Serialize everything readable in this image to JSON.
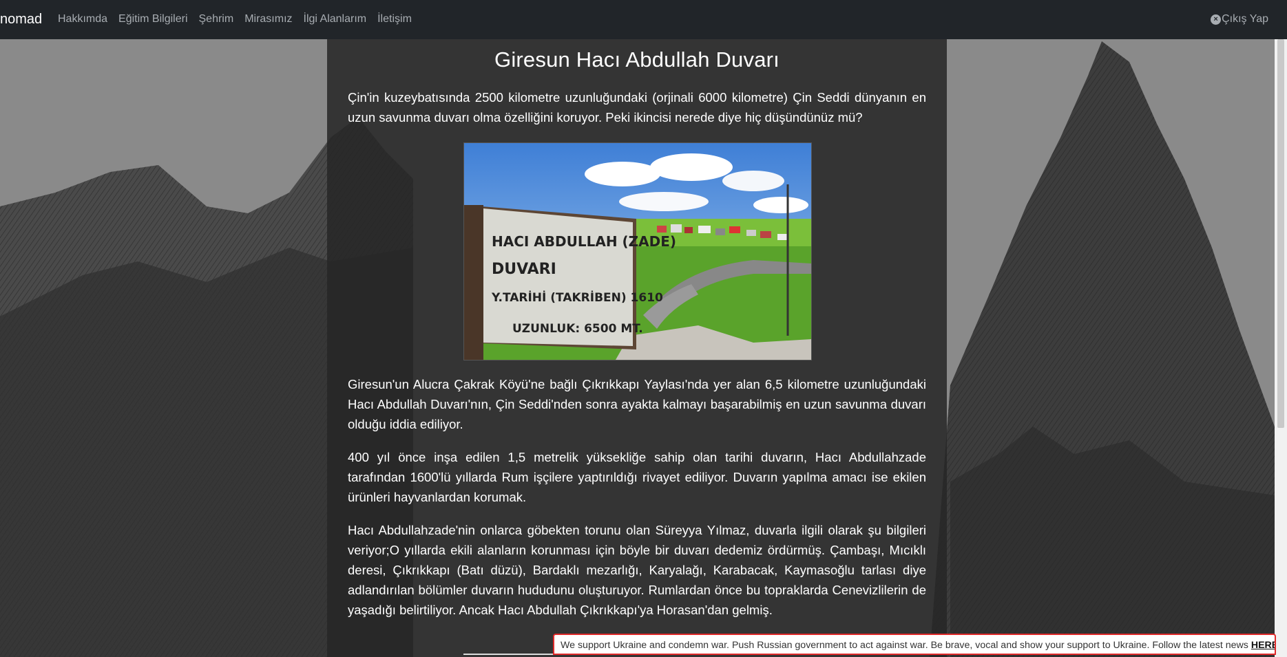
{
  "navbar": {
    "brand": "nomad",
    "links": [
      "Hakkımda",
      "Eğitim Bilgileri",
      "Şehrim",
      "Mirasımız",
      "İlgi Alanlarım",
      "İletişim"
    ],
    "logout_label": "Çıkış Yap",
    "logout_icon": "x-circle-icon"
  },
  "article": {
    "title": "Giresun Hacı Abdullah Duvarı",
    "intro": "Çin'in kuzeybatısında 2500 kilometre uzunluğundaki (orjinali 6000 kilometre) Çin Seddi dünyanın en uzun savunma duvarı olma özelliğini koruyor. Peki ikincisi nerede diye hiç düşündünüz mü?",
    "image_sign": [
      "HACI ABDULLAH (ZADE)",
      "DUVARI",
      "Y.TARİHİ (TAKRİBEN) 1610",
      "UZUNLUK: 6500 MT."
    ],
    "paragraphs": [
      "Giresun'un Alucra Çakrak Köyü'ne bağlı Çıkrıkkapı Yaylası'nda yer alan 6,5 kilometre uzunluğundaki Hacı Abdullah Duvarı'nın, Çin Seddi'nden sonra ayakta kalmayı başarabilmiş en uzun savunma duvarı olduğu iddia ediliyor.",
      "400 yıl önce inşa edilen 1,5 metrelik yüksekliğe sahip olan tarihi duvarın, Hacı Abdullahzade tarafından 1600'lü yıllarda Rum işçilere yaptırıldığı rivayet ediliyor. Duvarın yapılma amacı ise ekilen ürünleri hayvanlardan korumak.",
      "Hacı Abdullahzade'nin onlarca göbekten torunu olan Süreyya Yılmaz, duvarla ilgili olarak şu bilgileri veriyor;O yıllarda ekili alanların korunması için böyle bir duvarı dedemiz ördürmüş. Çambaşı, Mıcıklı deresi, Çıkrıkkapı (Batı düzü), Bardaklı mezarlığı, Karyalağı, Karabacak, Kaymasoğlu tarlası diye adlandırılan bölümler duvarın hududunu oluşturuyor. Rumlardan önce bu topraklarda Cenevizlilerin de yaşadığı belirtiliyor. Ancak Hacı Abdullah Çıkrıkkapı'ya Horasan'dan gelmiş."
    ]
  },
  "banner": {
    "text": "We support Ukraine and condemn war. Push Russian government to act against war. Be brave, vocal and show your support to Ukraine. Follow the latest news ",
    "link": "HERE",
    "border_color": "#e02a2a"
  }
}
